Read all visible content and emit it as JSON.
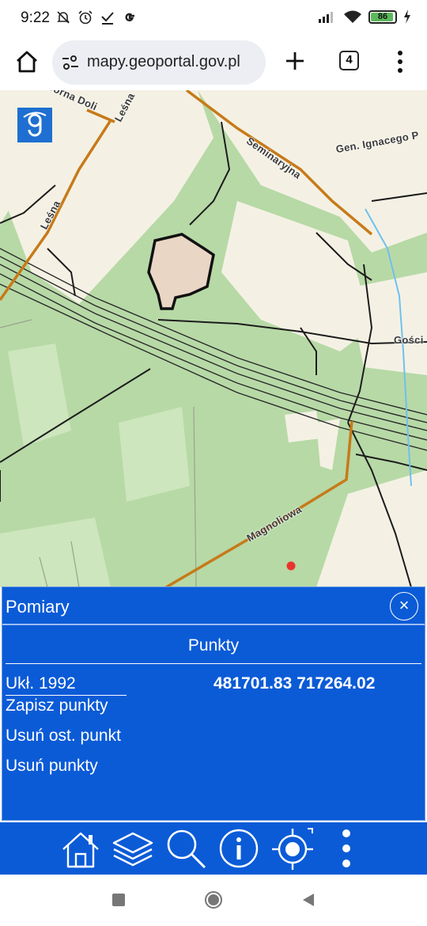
{
  "status_bar": {
    "time": "9:22",
    "left_icons": [
      "muted-bell-icon",
      "alarm-icon",
      "check-icon",
      "google-icon"
    ],
    "right_icons": [
      "signal-icon",
      "wifi-icon",
      "battery-icon",
      "charging-icon"
    ],
    "battery_level": "86"
  },
  "browser": {
    "url": "mapy.geoportal.gov.pl",
    "tab_count": "4"
  },
  "map": {
    "labels": {
      "gorna_dolina": "Górna Doli",
      "lesna_1": "Leśna",
      "lesna_2": "Leśna",
      "seminaryjna": "Seminaryjna",
      "gen_ignacego": "Gen. Ignacego P",
      "gosci": "Gości",
      "magnoliowa": "Magnoliowa"
    },
    "colors": {
      "forest": "#b7d9a6",
      "open": "#f4f1e4",
      "road_major": "#c77a19",
      "rail": "#2a2a2a",
      "water": "#6fc0ee",
      "building": "#ead6c5",
      "marker": "#e8352e"
    }
  },
  "panel": {
    "title": "Pomiary",
    "subtitle": "Punkty",
    "coord_system": "Ukł. 1992",
    "coordinates": "481701.83 717264.02",
    "actions": [
      "Zapisz punkty",
      "Usuń ost. punkt",
      "Usuń punkty"
    ],
    "close_symbol": "×"
  },
  "toolbar": {
    "items": [
      "home-icon",
      "layers-icon",
      "search-icon",
      "info-icon",
      "locate-icon",
      "more-icon"
    ]
  },
  "colors": {
    "accent": "#0b5bd7",
    "logo": "#1e6fd1"
  }
}
